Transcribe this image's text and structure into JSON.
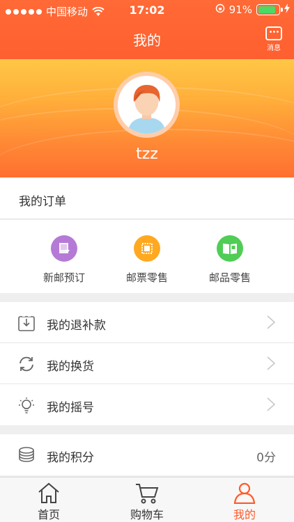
{
  "status_bar": {
    "carrier": "中国移动",
    "time": "17:02",
    "battery": "91%"
  },
  "nav": {
    "title": "我的",
    "message_label": "消息"
  },
  "profile": {
    "username": "tzz"
  },
  "orders": {
    "heading": "我的订单",
    "items": [
      {
        "label": "新邮预订",
        "icon": "new-stamp-icon",
        "color": "#b57ad6"
      },
      {
        "label": "邮票零售",
        "icon": "stamp-icon",
        "color": "#ffa921"
      },
      {
        "label": "邮品零售",
        "icon": "album-icon",
        "color": "#4fcd55"
      }
    ]
  },
  "list_group1": [
    {
      "label": "我的退补款",
      "icon": "refund-icon"
    },
    {
      "label": "我的换货",
      "icon": "exchange-icon"
    },
    {
      "label": "我的摇号",
      "icon": "lottery-icon"
    }
  ],
  "list_group2": [
    {
      "label": "我的积分",
      "icon": "coins-icon",
      "value": "0分"
    }
  ],
  "tabbar": {
    "items": [
      {
        "label": "首页",
        "icon": "home-icon"
      },
      {
        "label": "购物车",
        "icon": "cart-icon"
      },
      {
        "label": "我的",
        "icon": "user-icon"
      }
    ],
    "active_color": "#ff5a2a"
  },
  "colors": {
    "brand": "#ff5f2f",
    "banner_top": "#ffc746",
    "banner_bottom": "#ff6f30"
  }
}
